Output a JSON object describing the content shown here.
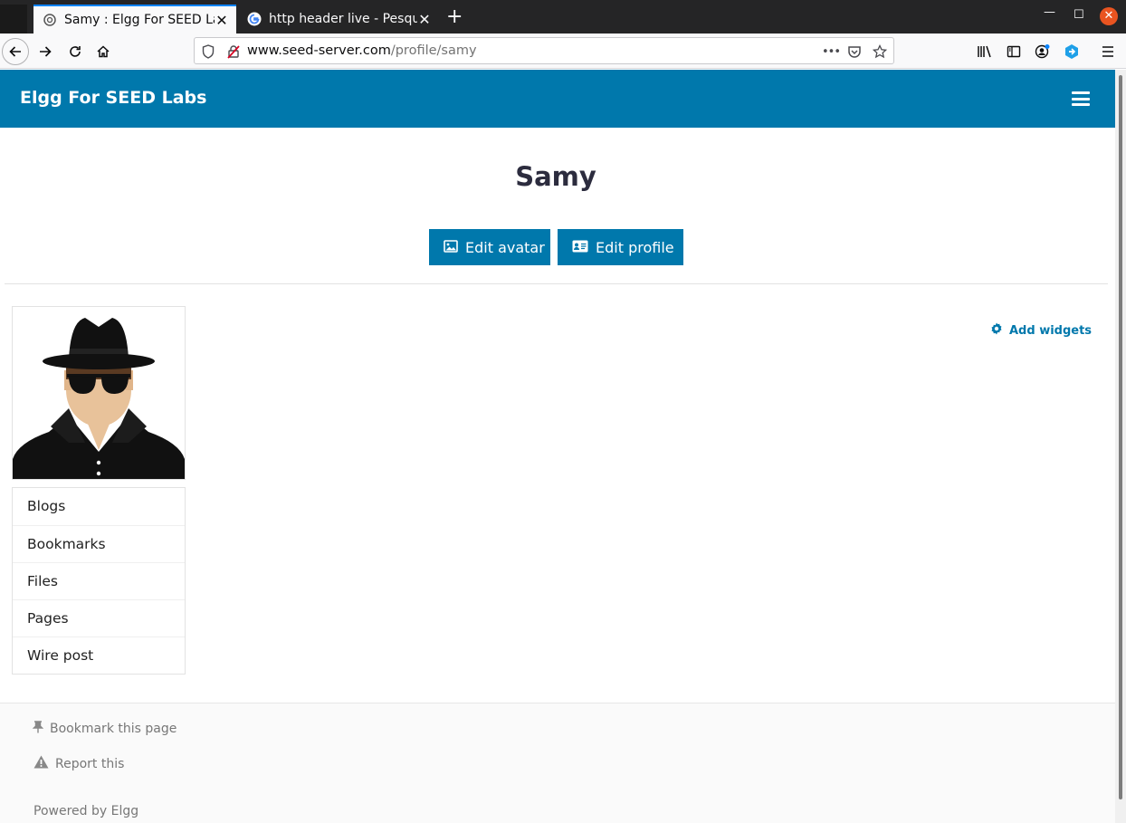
{
  "browser": {
    "tabs": [
      {
        "title": "Samy : Elgg For SEED Labs",
        "active": true
      },
      {
        "title": "http header live - Pesquisa Google",
        "active": false
      }
    ],
    "url_host": "www.seed-server.com",
    "url_path": "/profile/samy",
    "url_menu": "•••"
  },
  "site": {
    "name": "Elgg For SEED Labs",
    "accent": "#0078ac"
  },
  "profile": {
    "name": "Samy",
    "edit_avatar_label": "Edit avatar",
    "edit_profile_label": "Edit profile"
  },
  "owner_menu": {
    "items": [
      "Blogs",
      "Bookmarks",
      "Files",
      "Pages",
      "Wire post"
    ]
  },
  "widgets": {
    "add_label": "Add widgets"
  },
  "footer": {
    "bookmark_label": "Bookmark this page",
    "report_label": "Report this",
    "powered_label": "Powered by Elgg"
  }
}
